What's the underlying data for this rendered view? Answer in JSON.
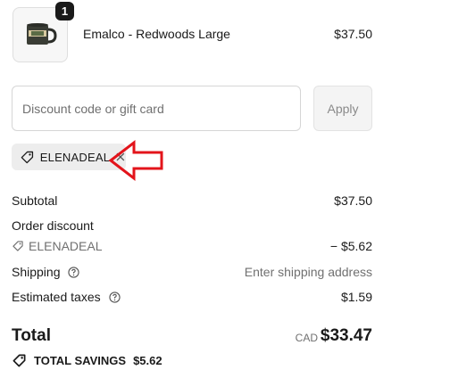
{
  "product": {
    "quantity": "1",
    "name": "Emalco - Redwoods Large",
    "price": "$37.50"
  },
  "discount": {
    "placeholder": "Discount code or gift card",
    "value": "",
    "apply_label": "Apply",
    "applied_code": "ELENADEAL"
  },
  "summary": {
    "subtotal_label": "Subtotal",
    "subtotal_value": "$37.50",
    "order_discount_label": "Order discount",
    "discount_code": "ELENADEAL",
    "discount_value": "− $5.62",
    "shipping_label": "Shipping",
    "shipping_value": "Enter shipping address",
    "taxes_label": "Estimated taxes",
    "taxes_value": "$1.59",
    "total_label": "Total",
    "total_currency": "CAD",
    "total_value": "$33.47",
    "savings_label": "TOTAL SAVINGS",
    "savings_value": "$5.62"
  },
  "icons": {
    "product_image": "mug-thumbnail",
    "code_tag": "tag-icon",
    "remove_code": "close-icon",
    "help": "help-circle-icon",
    "annotation": "red-arrow-icon"
  },
  "colors": {
    "annotation_arrow": "#e3141b",
    "pill_background": "#ededed",
    "muted_text": "#707070"
  }
}
